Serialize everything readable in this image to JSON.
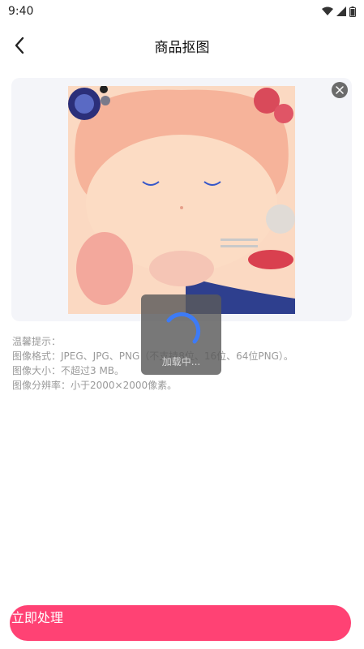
{
  "status_bar": {
    "time": "9:40",
    "icons": [
      "wifi-icon",
      "signal-icon",
      "battery-icon"
    ]
  },
  "nav": {
    "title": "商品抠图",
    "back_icon": "chevron-left-icon"
  },
  "preview": {
    "close_icon": "close-icon"
  },
  "tips": {
    "heading": "温馨提示：",
    "format": "图像格式：JPEG、JPG、PNG（不支持8位、16位、64位PNG）。",
    "size": "图像大小：不超过3 MB。",
    "resolution": "图像分辨率：小于2000×2000像素。"
  },
  "loading": {
    "text": "加载中..."
  },
  "action": {
    "button_label": "立即处理"
  },
  "colors": {
    "accent": "#ff4274",
    "spinner": "#3d7bf6",
    "card_bg": "#f4f5f9"
  }
}
